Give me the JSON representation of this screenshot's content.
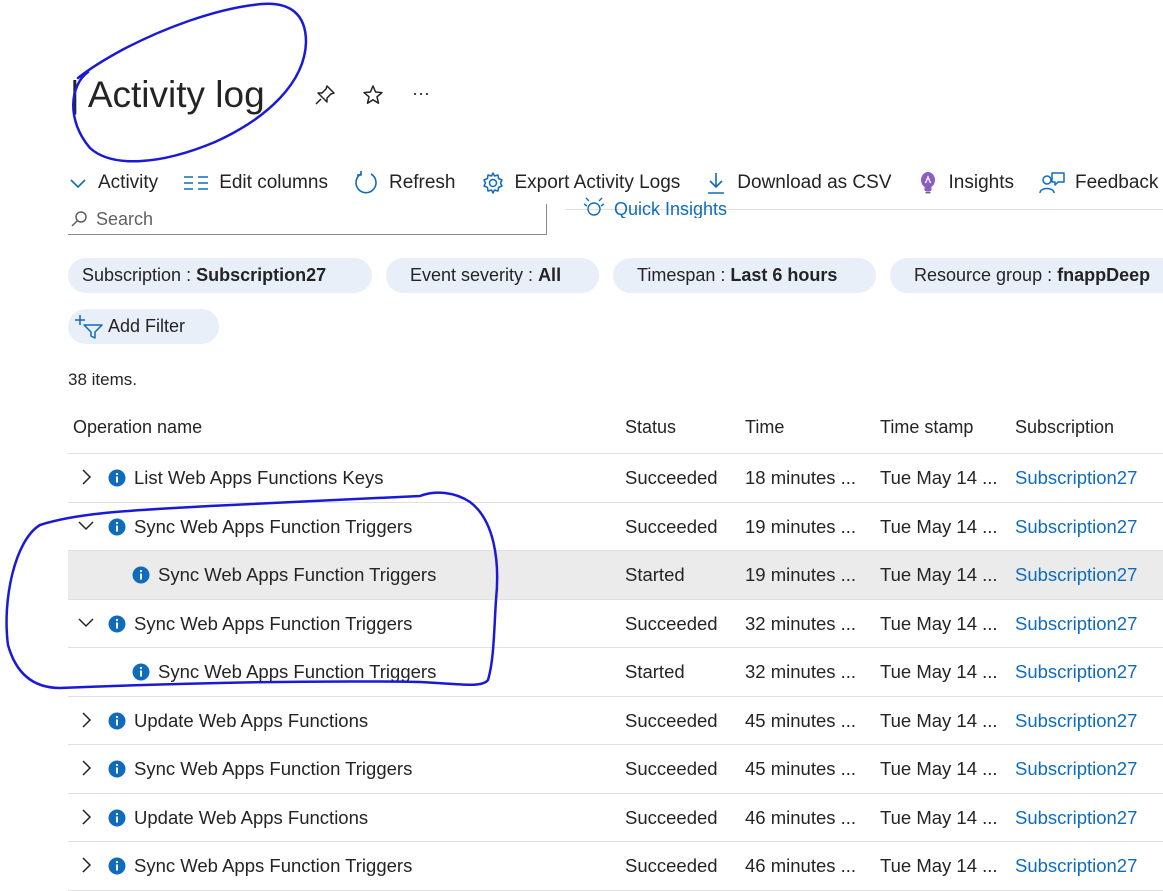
{
  "header": {
    "title": "| Activity log",
    "pin_icon": "pin-icon",
    "favorite_icon": "star-icon",
    "more_icon": "more-icon",
    "more_label": "···"
  },
  "toolbar": {
    "items": [
      {
        "label": "Activity",
        "icon": "chevron-down-icon"
      },
      {
        "label": "Edit columns",
        "icon": "edit-columns-icon"
      },
      {
        "label": "Refresh",
        "icon": "refresh-icon"
      },
      {
        "label": "Export Activity Logs",
        "icon": "gear-icon"
      },
      {
        "label": "Download as CSV",
        "icon": "download-icon"
      },
      {
        "label": "Insights",
        "icon": "lightbulb-icon"
      },
      {
        "label": "Feedback",
        "icon": "feedback-icon"
      }
    ]
  },
  "search": {
    "placeholder": "Search",
    "value": ""
  },
  "quick_insights": {
    "label": "Quick Insights"
  },
  "filters": [
    {
      "key": "Subscription",
      "value": "Subscription27"
    },
    {
      "key": "Event severity",
      "value": "All"
    },
    {
      "key": "Timespan",
      "value": "Last 6 hours"
    },
    {
      "key": "Resource group",
      "value": "fnappDeep"
    }
  ],
  "add_filter": {
    "label": "Add Filter"
  },
  "items_count": "38 items.",
  "table": {
    "columns": [
      "Operation name",
      "Status",
      "Time",
      "Time stamp",
      "Subscription"
    ],
    "rows": [
      {
        "operation": "List Web Apps Functions Keys",
        "status": "Succeeded",
        "time": "18 minutes ...",
        "timestamp": "Tue May 14 ...",
        "subscription": "Subscription27",
        "expander": "collapsed",
        "child": false,
        "selected": false
      },
      {
        "operation": "Sync Web Apps Function Triggers",
        "status": "Succeeded",
        "time": "19 minutes ...",
        "timestamp": "Tue May 14 ...",
        "subscription": "Subscription27",
        "expander": "expanded",
        "child": false,
        "selected": false
      },
      {
        "operation": "Sync Web Apps Function Triggers",
        "status": "Started",
        "time": "19 minutes ...",
        "timestamp": "Tue May 14 ...",
        "subscription": "Subscription27",
        "expander": "none",
        "child": true,
        "selected": true
      },
      {
        "operation": "Sync Web Apps Function Triggers",
        "status": "Succeeded",
        "time": "32 minutes ...",
        "timestamp": "Tue May 14 ...",
        "subscription": "Subscription27",
        "expander": "expanded",
        "child": false,
        "selected": false
      },
      {
        "operation": "Sync Web Apps Function Triggers",
        "status": "Started",
        "time": "32 minutes ...",
        "timestamp": "Tue May 14 ...",
        "subscription": "Subscription27",
        "expander": "none",
        "child": true,
        "selected": false
      },
      {
        "operation": "Update Web Apps Functions",
        "status": "Succeeded",
        "time": "45 minutes ...",
        "timestamp": "Tue May 14 ...",
        "subscription": "Subscription27",
        "expander": "collapsed",
        "child": false,
        "selected": false
      },
      {
        "operation": "Sync Web Apps Function Triggers",
        "status": "Succeeded",
        "time": "45 minutes ...",
        "timestamp": "Tue May 14 ...",
        "subscription": "Subscription27",
        "expander": "collapsed",
        "child": false,
        "selected": false
      },
      {
        "operation": "Update Web Apps Functions",
        "status": "Succeeded",
        "time": "46 minutes ...",
        "timestamp": "Tue May 14 ...",
        "subscription": "Subscription27",
        "expander": "collapsed",
        "child": false,
        "selected": false
      },
      {
        "operation": "Sync Web Apps Function Triggers",
        "status": "Succeeded",
        "time": "46 minutes ...",
        "timestamp": "Tue May 14 ...",
        "subscription": "Subscription27",
        "expander": "collapsed",
        "child": false,
        "selected": false
      }
    ]
  },
  "colors": {
    "accent": "#0f6cbd",
    "pill_bg": "#e8eff8",
    "selected_row": "#ebebeb",
    "annotation_ink": "#1a1ad6",
    "insights_icon": "#8a5cc4"
  }
}
